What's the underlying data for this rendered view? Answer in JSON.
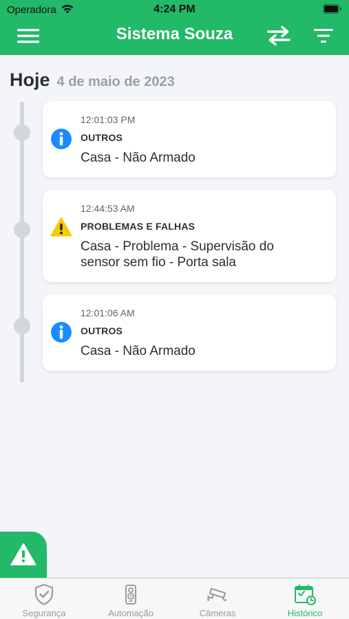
{
  "status_bar": {
    "carrier": "Operadora",
    "time": "4:24 PM"
  },
  "header": {
    "title": "Sistema Souza",
    "background": "#22b968"
  },
  "date_group": {
    "label": "Hoje",
    "date": "4 de maio de 2023"
  },
  "events": [
    {
      "time": "12:01:03 PM",
      "category": "OUTROS",
      "icon": "info-icon",
      "description": "Casa - Não Armado"
    },
    {
      "time": "12:44:53 AM",
      "category": "PROBLEMAS E FALHAS",
      "icon": "warning-icon",
      "description": "Casa - Problema - Supervisão do sensor sem fio -  Porta sala"
    },
    {
      "time": "12:01:06 AM",
      "category": "OUTROS",
      "icon": "info-icon",
      "description": "Casa - Não Armado"
    }
  ],
  "bottom_nav": {
    "items": [
      {
        "label": "Segurança",
        "icon": "shield-check-icon"
      },
      {
        "label": "Automação",
        "icon": "remote-control-icon"
      },
      {
        "label": "Câmeras",
        "icon": "security-camera-icon"
      },
      {
        "label": "Histórico",
        "icon": "calendar-history-icon",
        "active": true
      }
    ]
  },
  "colors": {
    "accent": "#22b968",
    "info": "#1a8cff",
    "warning": "#f5cc00"
  }
}
